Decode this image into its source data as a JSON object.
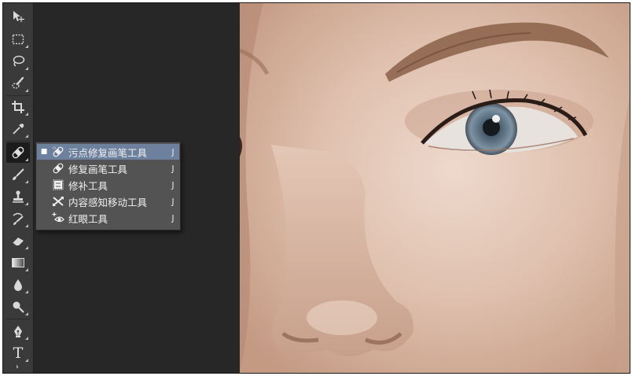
{
  "toolbar": {
    "tools": [
      {
        "name": "move-tool",
        "icon": "move-icon"
      },
      {
        "name": "marquee-tool",
        "icon": "marquee-icon"
      },
      {
        "name": "lasso-tool",
        "icon": "lasso-icon"
      },
      {
        "name": "quick-selection-tool",
        "icon": "quick-selection-icon"
      },
      {
        "name": "crop-tool",
        "icon": "crop-icon"
      },
      {
        "name": "eyedropper-tool",
        "icon": "eyedropper-icon"
      },
      {
        "name": "healing-brush-tool",
        "icon": "bandage-icon",
        "active": true
      },
      {
        "name": "brush-tool",
        "icon": "brush-icon"
      },
      {
        "name": "clone-stamp-tool",
        "icon": "stamp-icon"
      },
      {
        "name": "history-brush-tool",
        "icon": "history-brush-icon"
      },
      {
        "name": "eraser-tool",
        "icon": "eraser-icon"
      },
      {
        "name": "gradient-tool",
        "icon": "gradient-icon"
      },
      {
        "name": "blur-tool",
        "icon": "drop-icon"
      },
      {
        "name": "dodge-tool",
        "icon": "dodge-icon"
      },
      {
        "name": "pen-tool",
        "icon": "pen-icon"
      },
      {
        "name": "type-tool",
        "icon": "type-icon",
        "glyph": "T"
      }
    ]
  },
  "flyout": {
    "items": [
      {
        "label": "污点修复画笔工具",
        "shortcut": "J",
        "icon": "spot-healing-icon",
        "selected": true,
        "bullet": "■"
      },
      {
        "label": "修复画笔工具",
        "shortcut": "J",
        "icon": "bandage-icon",
        "selected": false,
        "bullet": ""
      },
      {
        "label": "修补工具",
        "shortcut": "J",
        "icon": "patch-icon",
        "selected": false,
        "bullet": ""
      },
      {
        "label": "内容感知移动工具",
        "shortcut": "J",
        "icon": "content-aware-move-icon",
        "selected": false,
        "bullet": ""
      },
      {
        "label": "红眼工具",
        "shortcut": "J",
        "icon": "red-eye-icon",
        "selected": false,
        "bullet": ""
      }
    ]
  },
  "colors": {
    "toolbar_bg": "#3a3a3a",
    "menu_bg": "#535353",
    "menu_selected": "#6d809d",
    "workspace": "#272727"
  }
}
